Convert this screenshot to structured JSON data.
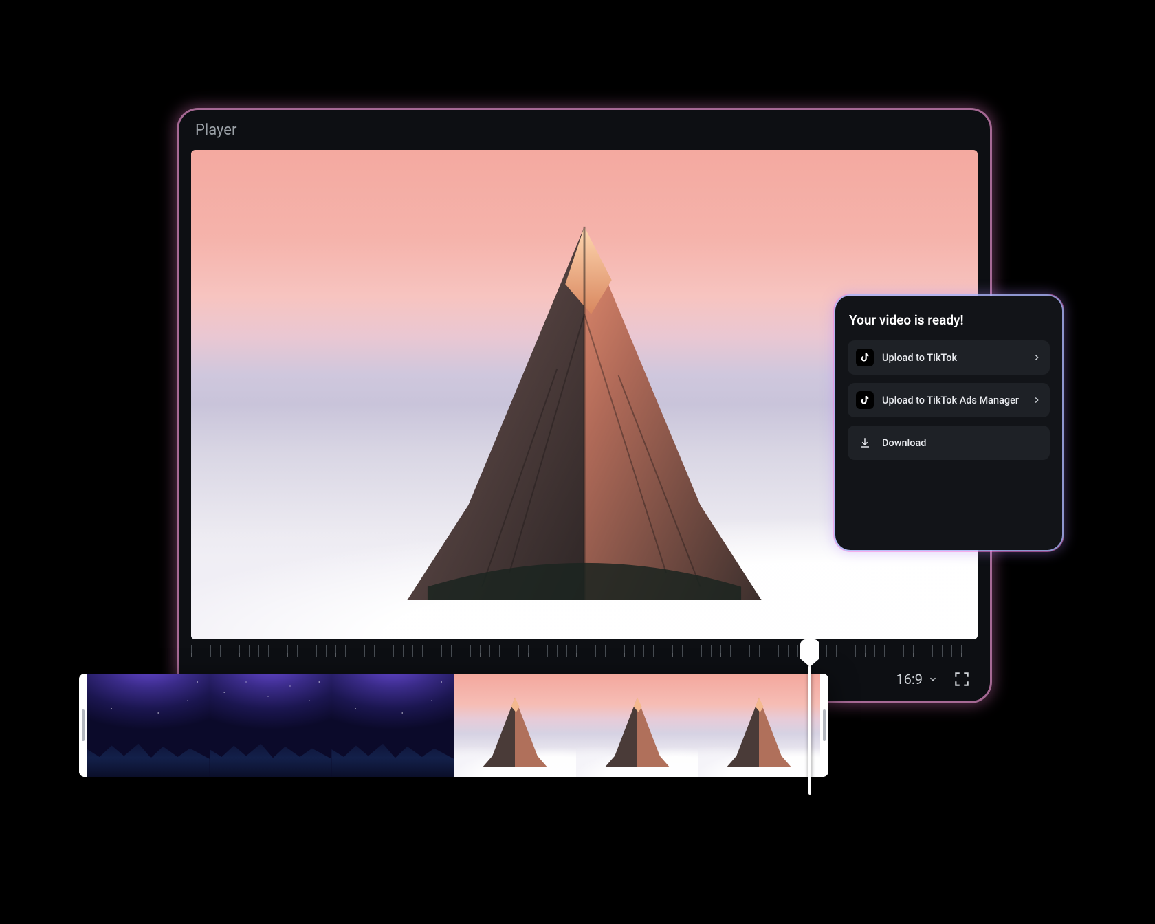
{
  "player": {
    "title": "Player",
    "aspect_ratio": "16:9"
  },
  "export_panel": {
    "title": "Your video is ready!",
    "options": [
      {
        "label": "Upload to TikTok",
        "icon": "tiktok-icon",
        "has_chevron": true
      },
      {
        "label": "Upload to TikTok Ads Manager",
        "icon": "tiktok-ads-icon",
        "has_chevron": true
      },
      {
        "label": "Download",
        "icon": "download-icon",
        "has_chevron": false
      }
    ]
  },
  "timeline": {
    "clips": [
      {
        "kind": "night-mountain"
      },
      {
        "kind": "night-mountain"
      },
      {
        "kind": "night-mountain"
      },
      {
        "kind": "sunset-mountain"
      },
      {
        "kind": "sunset-mountain"
      },
      {
        "kind": "sunset-mountain"
      }
    ]
  }
}
